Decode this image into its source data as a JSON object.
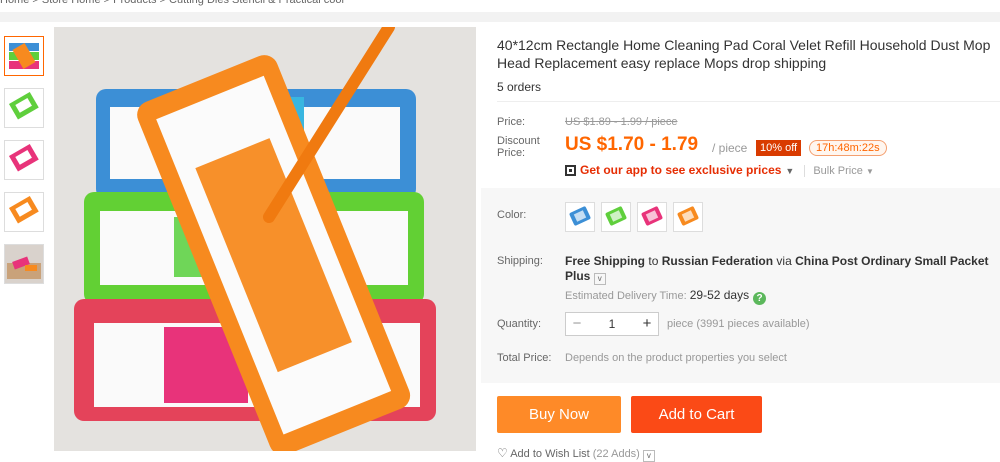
{
  "breadcrumb": "Home > Store Home > Products > Cutting Dies Stencil & Practical cool",
  "product": {
    "title": "40*12cm Rectangle Home Cleaning Pad Coral Velet Refill Household Dust Mop Head Replacement easy replace Mops drop shipping",
    "orders": "5 orders"
  },
  "price": {
    "label": "Price:",
    "original": "US $1.89 - 1.99 / piece",
    "discount_label": "Discount Price:",
    "discount": "US $1.70 - 1.79",
    "unit": "/ piece",
    "off_badge": "10% off",
    "timer": "17h:48m:22s"
  },
  "app_promo": {
    "text": "Get our app to see exclusive prices",
    "bulk": "Bulk Price"
  },
  "color": {
    "label": "Color:",
    "swatches": [
      {
        "name": "blue",
        "hex": "#3c8fd6"
      },
      {
        "name": "green",
        "hex": "#5fcf3c"
      },
      {
        "name": "pink",
        "hex": "#e8337a"
      },
      {
        "name": "orange",
        "hex": "#f78a1f"
      }
    ]
  },
  "shipping": {
    "label": "Shipping:",
    "free": "Free Shipping",
    "to": "to",
    "country": "Russian Federation",
    "via": "via",
    "carrier": "China Post Ordinary Small Packet Plus",
    "est_label": "Estimated Delivery Time:",
    "est_days": "29-52 days"
  },
  "quantity": {
    "label": "Quantity:",
    "value": "1",
    "available": "piece (3991 pieces available)"
  },
  "total": {
    "label": "Total Price:",
    "note": "Depends on the product properties you select"
  },
  "actions": {
    "buy_now": "Buy Now",
    "add_to_cart": "Add to Cart",
    "wish_list": "Add to Wish List",
    "wish_count": "(22 Adds)"
  },
  "colors": {
    "accent": "#ff6600",
    "buy": "#fe8a28",
    "cart": "#fb4a16",
    "badge": "#d93b00"
  }
}
